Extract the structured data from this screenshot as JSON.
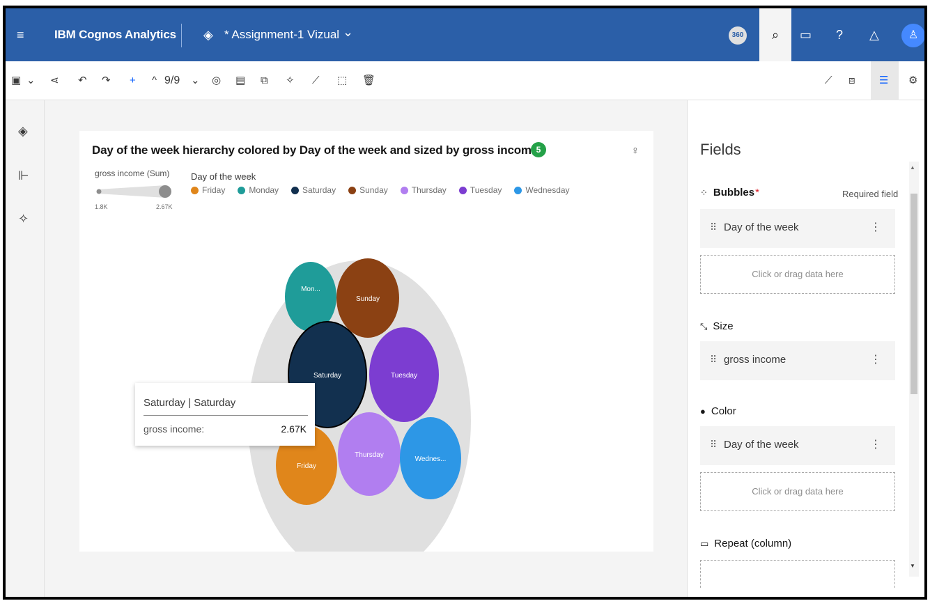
{
  "header": {
    "menu_icon": "hamburger-icon",
    "brand": "IBM Cognos Analytics",
    "doc_title": "* Assignment-1 Vizual",
    "badge_360": "360"
  },
  "toolbar": {
    "page_indicator": "9/9"
  },
  "chart": {
    "title": "Day of the week hierarchy colored by Day of the week and sized by gross income",
    "badge_count": "5",
    "size_legend": {
      "title": "gross income (Sum)",
      "min_label": "1.8K",
      "max_label": "2.67K"
    },
    "color_legend_title": "Day of the week",
    "legend": [
      {
        "label": "Friday",
        "color": "#e0861b"
      },
      {
        "label": "Monday",
        "color": "#1f9c99"
      },
      {
        "label": "Saturday",
        "color": "#12304f"
      },
      {
        "label": "Sunday",
        "color": "#8b4113"
      },
      {
        "label": "Thursday",
        "color": "#b17ef0"
      },
      {
        "label": "Tuesday",
        "color": "#7c3dd1"
      },
      {
        "label": "Wednesday",
        "color": "#2d97e6"
      }
    ],
    "tooltip": {
      "title": "Saturday | Saturday",
      "label": "gross income:",
      "value": "2.67K"
    }
  },
  "chart_data": {
    "type": "bubble",
    "title": "Day of the week hierarchy colored by Day of the week and sized by gross income",
    "size_measure": "gross income (Sum)",
    "size_range": [
      "1.8K",
      "2.67K"
    ],
    "bubbles": [
      {
        "label": "Mon...",
        "category": "Monday",
        "value": 2.1,
        "color": "#1f9c99"
      },
      {
        "label": "Sunday",
        "category": "Sunday",
        "value": 2.3,
        "color": "#8b4113"
      },
      {
        "label": "Saturday",
        "category": "Saturday",
        "value": 2.67,
        "color": "#12304f"
      },
      {
        "label": "Tuesday",
        "category": "Tuesday",
        "value": 2.6,
        "color": "#7c3dd1"
      },
      {
        "label": "Friday",
        "category": "Friday",
        "value": 2.3,
        "color": "#e0861b"
      },
      {
        "label": "Thursday",
        "category": "Thursday",
        "value": 2.3,
        "color": "#b17ef0"
      },
      {
        "label": "Wednes...",
        "category": "Wednesday",
        "value": 2.4,
        "color": "#2d97e6"
      }
    ]
  },
  "fields_panel": {
    "title": "Fields",
    "bubbles_label": "Bubbles",
    "required_star": "*",
    "required_text": "Required field",
    "bubbles_field": "Day of the week",
    "drop_text_1": "Click or drag data here",
    "size_label": "Size",
    "size_field": "gross income",
    "color_label": "Color",
    "color_field": "Day of the week",
    "drop_text_2": "Click or drag data here",
    "repeat_label": "Repeat (column)"
  }
}
